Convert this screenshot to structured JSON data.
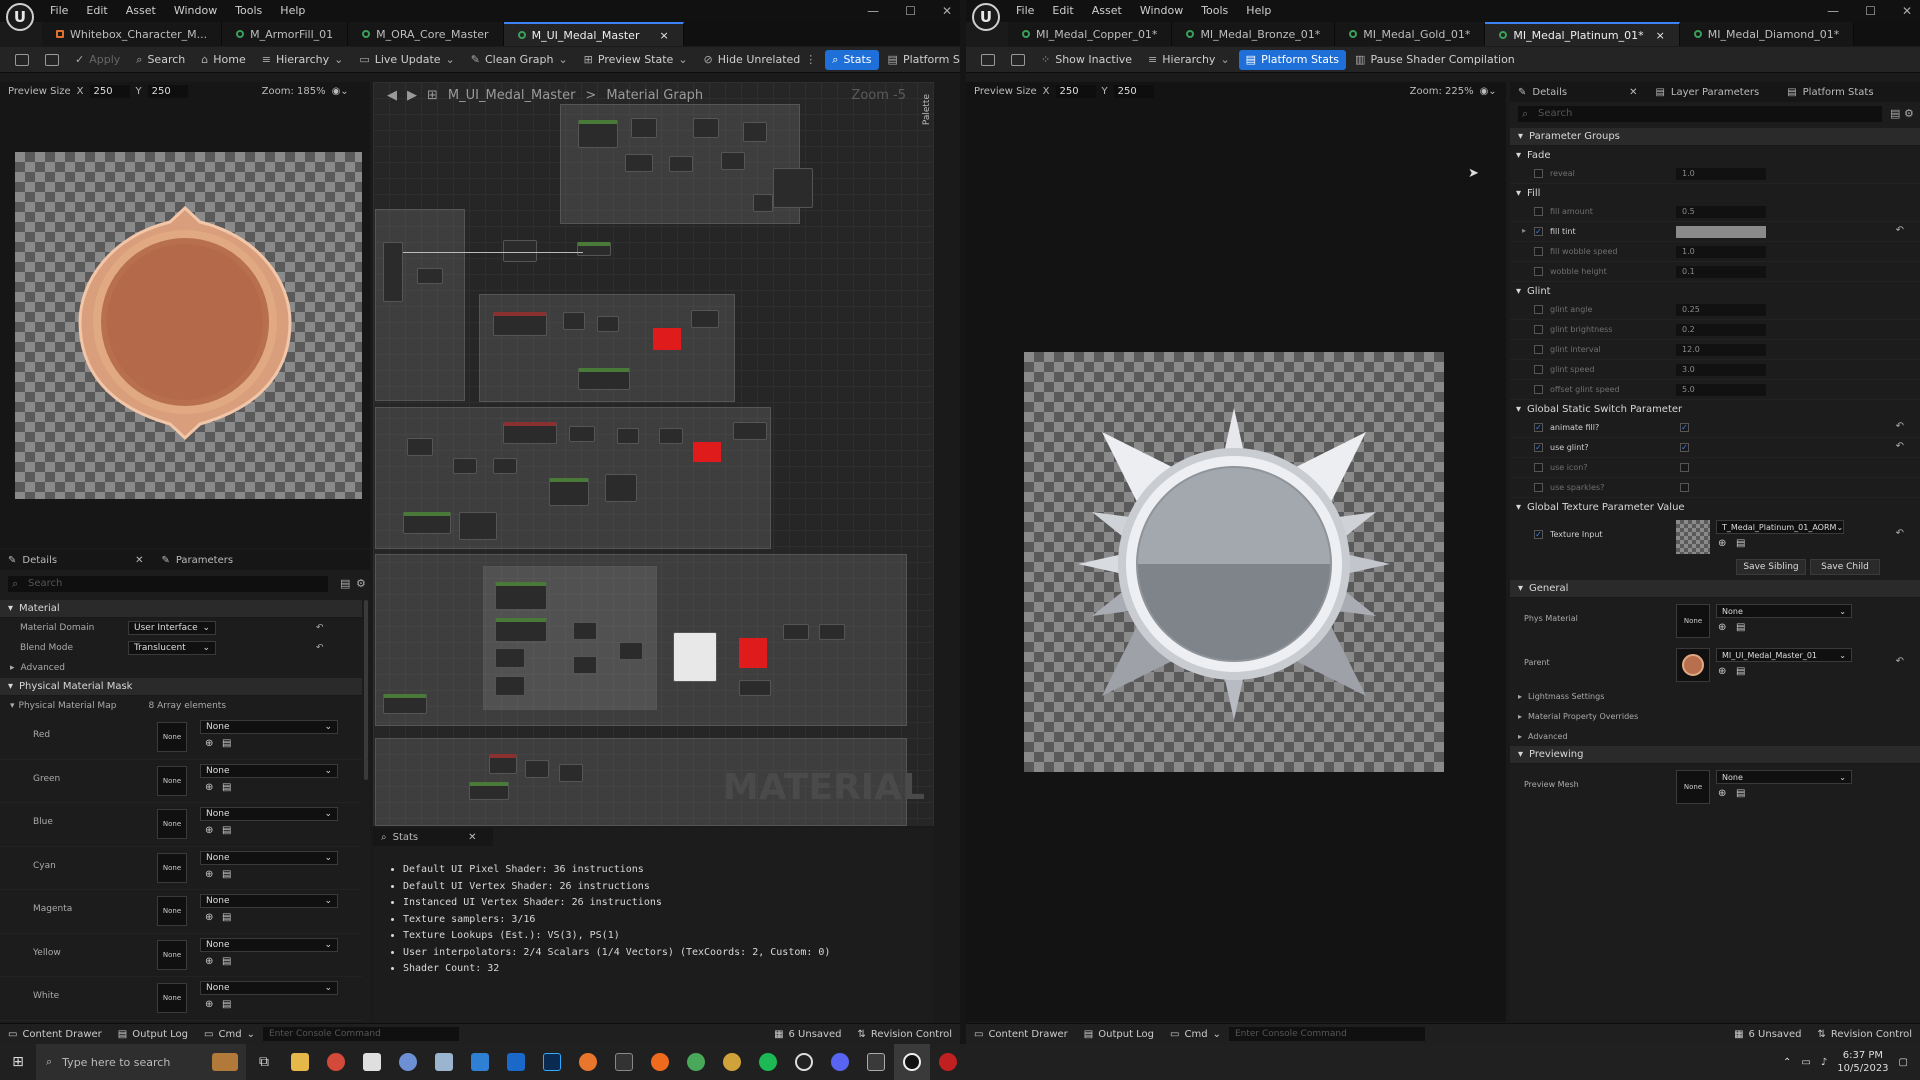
{
  "left": {
    "menu": [
      "File",
      "Edit",
      "Asset",
      "Window",
      "Tools",
      "Help"
    ],
    "tabs": [
      {
        "label": "Whitebox_Character_M..."
      },
      {
        "label": "M_ArmorFill_01"
      },
      {
        "label": "M_ORA_Core_Master"
      },
      {
        "label": "M_UI_Medal_Master",
        "close": "×"
      }
    ],
    "toolbar": [
      "Apply",
      "Search",
      "Home",
      "Hierarchy",
      "Live Update",
      "Clean Graph",
      "Preview State",
      "Hide Unrelated",
      "Stats",
      "Platform Stats"
    ],
    "preview": {
      "size_label": "Preview Size",
      "x_label": "X",
      "x": "250",
      "y_label": "Y",
      "y": "250",
      "zoom": "Zoom: 185%"
    },
    "graph": {
      "breadcrumb_root": "M_UI_Medal_Master",
      "breadcrumb_sep": ">",
      "breadcrumb_leaf": "Material Graph",
      "zoom": "Zoom -5",
      "palette": "Palette",
      "watermark": "MATERIAL"
    },
    "details": {
      "tab_details": "Details",
      "tab_params": "Parameters",
      "search_placeholder": "Search",
      "section_material": "Material",
      "domain_label": "Material Domain",
      "domain_value": "User Interface",
      "blend_label": "Blend Mode",
      "blend_value": "Translucent",
      "advanced": "Advanced",
      "section_phys": "Physical Material Mask",
      "map_label": "Physical Material Map",
      "map_count": "8 Array elements",
      "channels": [
        {
          "name": "Red",
          "thumb": "None",
          "value": "None"
        },
        {
          "name": "Green",
          "thumb": "None",
          "value": "None"
        },
        {
          "name": "Blue",
          "thumb": "None",
          "value": "None"
        },
        {
          "name": "Cyan",
          "thumb": "None",
          "value": "None"
        },
        {
          "name": "Magenta",
          "thumb": "None",
          "value": "None"
        },
        {
          "name": "Yellow",
          "thumb": "None",
          "value": "None"
        },
        {
          "name": "White",
          "thumb": "None",
          "value": "None"
        }
      ]
    },
    "stats": {
      "tab": "Stats",
      "lines": [
        "Default UI Pixel Shader: 36 instructions",
        "Default UI Vertex Shader: 26 instructions",
        "Instanced UI Vertex Shader: 26 instructions",
        "Texture samplers: 3/16",
        "Texture Lookups (Est.): VS(3), PS(1)",
        "User interpolators: 2/4 Scalars (1/4 Vectors) (TexCoords: 2, Custom: 0)",
        "Shader Count: 32"
      ]
    },
    "status": {
      "content_drawer": "Content Drawer",
      "output_log": "Output Log",
      "cmd": "Cmd",
      "console_placeholder": "Enter Console Command",
      "unsaved": "6 Unsaved",
      "revision": "Revision Control"
    }
  },
  "right": {
    "menu": [
      "File",
      "Edit",
      "Asset",
      "Window",
      "Tools",
      "Help"
    ],
    "tabs": [
      {
        "label": "MI_Medal_Copper_01*"
      },
      {
        "label": "MI_Medal_Bronze_01*"
      },
      {
        "label": "MI_Medal_Gold_01*"
      },
      {
        "label": "MI_Medal_Platinum_01*",
        "close": "×"
      },
      {
        "label": "MI_Medal_Diamond_01*"
      }
    ],
    "toolbar": [
      "Show Inactive",
      "Hierarchy",
      "Platform Stats",
      "Pause Shader Compilation"
    ],
    "preview": {
      "size_label": "Preview Size",
      "x_label": "X",
      "x": "250",
      "y_label": "Y",
      "y": "250",
      "zoom": "Zoom: 225%"
    },
    "details": {
      "tab_details": "Details",
      "tab_layer": "Layer Parameters",
      "tab_platform": "Platform Stats",
      "search_placeholder": "Search",
      "param_groups": "Parameter Groups",
      "fade": "Fade",
      "fade_rows": [
        {
          "name": "reveal",
          "value": "1.0"
        }
      ],
      "fill": "Fill",
      "fill_rows": [
        {
          "name": "fill amount",
          "value": "0.5",
          "checked": false
        },
        {
          "name": "fill tint",
          "value": "",
          "checked": true
        },
        {
          "name": "fill wobble speed",
          "value": "1.0",
          "checked": false
        },
        {
          "name": "wobble height",
          "value": "0.1",
          "checked": false
        }
      ],
      "glint": "Glint",
      "glint_rows": [
        {
          "name": "glint angle",
          "value": "0.25"
        },
        {
          "name": "glint brightness",
          "value": "0.2"
        },
        {
          "name": "glint interval",
          "value": "12.0"
        },
        {
          "name": "glint speed",
          "value": "3.0"
        },
        {
          "name": "offset glint speed",
          "value": "5.0"
        }
      ],
      "switch_group": "Global Static Switch Parameter",
      "switch_rows": [
        {
          "name": "animate fill?",
          "checked": true,
          "val": true
        },
        {
          "name": "use glint?",
          "checked": true,
          "val": true
        },
        {
          "name": "use icon?",
          "checked": false,
          "val": false
        },
        {
          "name": "use sparkles?",
          "checked": false,
          "val": false
        }
      ],
      "texture_group": "Global Texture Parameter Value",
      "texture_name": "Texture Input",
      "texture_value": "T_Medal_Platinum_01_AORM",
      "save_sibling": "Save Sibling",
      "save_child": "Save Child",
      "general": "General",
      "phys_material": "Phys Material",
      "phys_thumb": "None",
      "phys_value": "None",
      "parent": "Parent",
      "parent_value": "MI_UI_Medal_Master_01",
      "lightmass": "Lightmass Settings",
      "overrides": "Material Property Overrides",
      "advanced": "Advanced",
      "previewing": "Previewing",
      "preview_mesh": "Preview Mesh",
      "preview_mesh_thumb": "None",
      "preview_mesh_value": "None"
    },
    "status": {
      "content_drawer": "Content Drawer",
      "output_log": "Output Log",
      "cmd": "Cmd",
      "console_placeholder": "Enter Console Command",
      "unsaved": "6 Unsaved",
      "revision": "Revision Control"
    }
  },
  "taskbar": {
    "search_placeholder": "Type here to search",
    "time": "6:37 PM",
    "date": "10/5/2023"
  },
  "colors": {
    "accent": "#1e6fd8",
    "copper": "#b86f4e",
    "platinum": "#c9ccd1",
    "red_node": "#e01b1b"
  }
}
